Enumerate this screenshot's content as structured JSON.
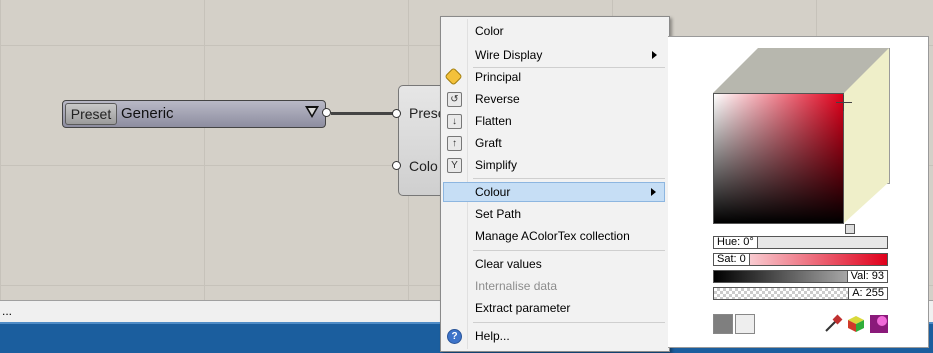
{
  "status": {
    "text": "..."
  },
  "preset": {
    "tag": "Preset",
    "value": "Generic"
  },
  "node": {
    "inputs": [
      "Prese",
      "Colo"
    ]
  },
  "menu": {
    "items": [
      {
        "label": "Color",
        "icon": ""
      },
      {
        "label": "Wire Display",
        "icon": "",
        "submenu": true
      },
      {
        "label": "Principal",
        "icon": "principal-icon"
      },
      {
        "label": "Reverse",
        "icon": "reverse-icon"
      },
      {
        "label": "Flatten",
        "icon": "flatten-icon"
      },
      {
        "label": "Graft",
        "icon": "graft-icon"
      },
      {
        "label": "Simplify",
        "icon": "simplify-icon"
      },
      {
        "label": "Colour",
        "icon": "",
        "submenu": true,
        "highlighted": true
      },
      {
        "label": "Set Path",
        "icon": ""
      },
      {
        "label": "Manage AColorTex collection",
        "icon": ""
      },
      {
        "label": "Clear values",
        "icon": ""
      },
      {
        "label": "Internalise data",
        "icon": "",
        "disabled": true
      },
      {
        "label": "Extract parameter",
        "icon": ""
      },
      {
        "label": "Help...",
        "icon": "help-icon"
      }
    ]
  },
  "picker": {
    "hue": "Hue: 0°",
    "sat": "Sat: 0",
    "val": "Val: 93",
    "alpha": "A: 255"
  },
  "colors": {
    "highlight": "#c6def5",
    "taskbar": "#1b5e9e"
  }
}
